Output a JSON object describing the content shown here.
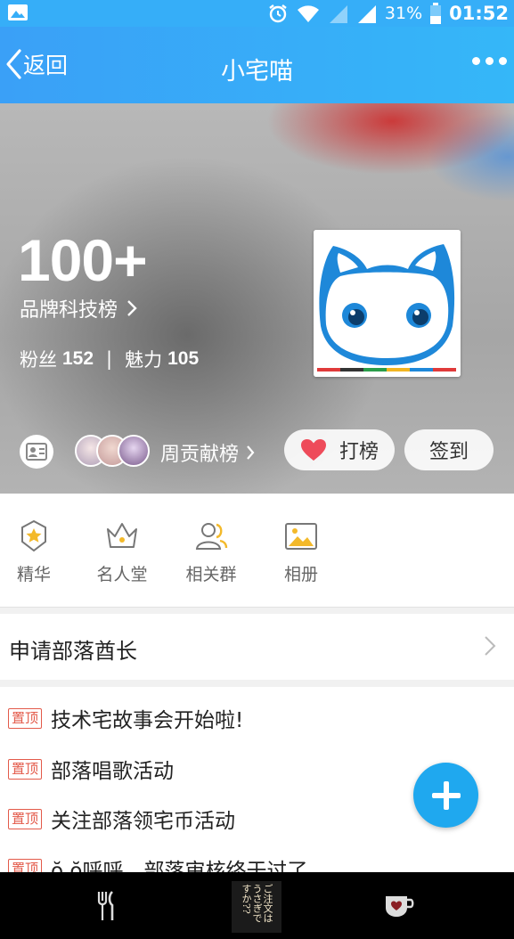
{
  "status_bar": {
    "battery": "31%",
    "time": "01:52"
  },
  "header": {
    "back_label": "返回",
    "title": "小宅喵"
  },
  "hero": {
    "rank_number": "100+",
    "rank_name": "品牌科技榜",
    "fans_label": "粉丝",
    "fans_count": "152",
    "separator": "|",
    "charm_label": "魅力",
    "charm_count": "105",
    "weekly_label": "周贡献榜",
    "rank_button": "打榜",
    "checkin_button": "签到"
  },
  "quick_menu": [
    {
      "label": "精华",
      "icon": "ribbon-star-icon"
    },
    {
      "label": "名人堂",
      "icon": "crown-icon"
    },
    {
      "label": "相关群",
      "icon": "group-icon"
    },
    {
      "label": "相册",
      "icon": "picture-icon"
    }
  ],
  "apply_row": {
    "label": "申请部落酋长"
  },
  "posts": {
    "pin_label": "置顶",
    "items": [
      "技术宅故事会开始啦!",
      "部落唱歌活动",
      "关注部落领宅币活动",
      "ŏ ŏ呼呼，部落审核终于过了。"
    ]
  },
  "nav": {
    "center_logo_text": "ご注文はうさぎですか??",
    "left_icon": "fork-knife-icon",
    "right_icon": "coffee-cup-heart-icon"
  },
  "colors": {
    "header_blue": "#36aef8",
    "fab_blue": "#1fa8ef",
    "pin_red": "#e35a4a",
    "heart_red": "#ee4b5a"
  }
}
